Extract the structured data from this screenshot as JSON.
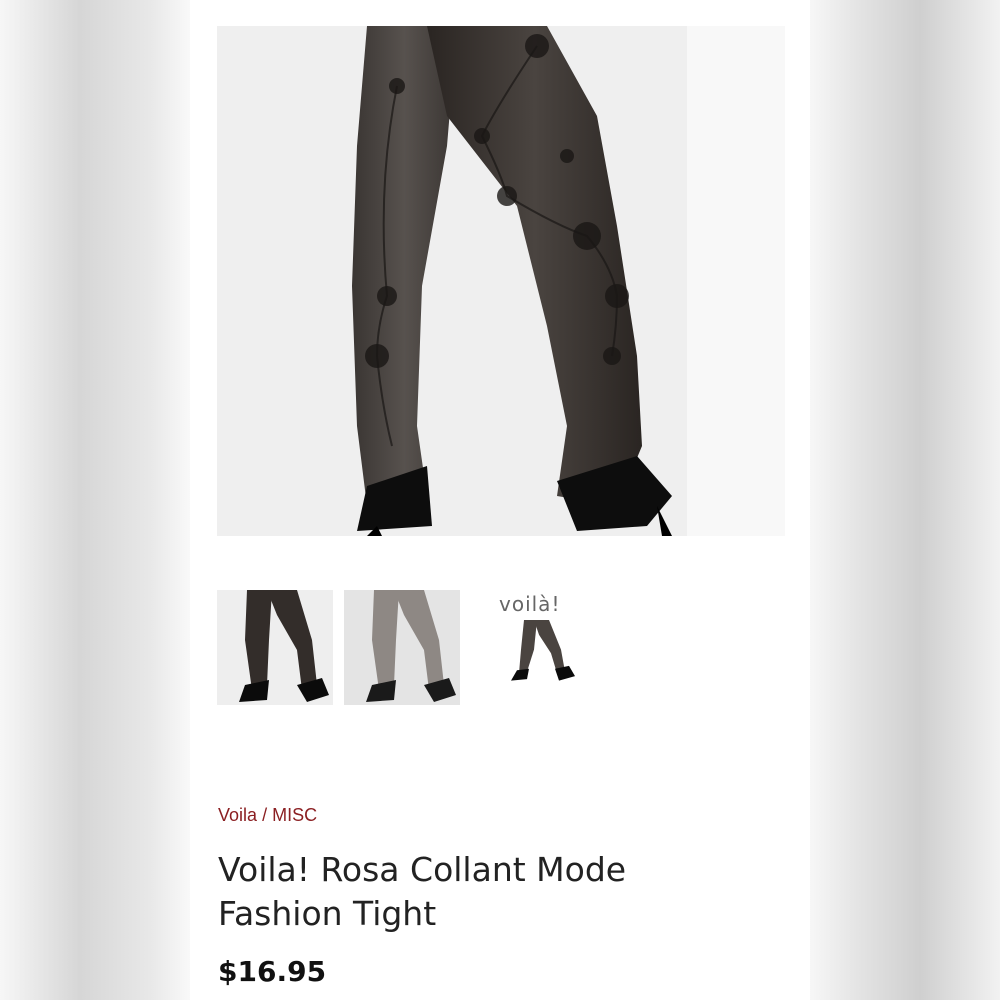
{
  "breadcrumb": {
    "brand": "Voila",
    "separator": "/",
    "category": "MISC"
  },
  "product": {
    "title": "Voila! Rosa Collant Mode Fashion Tight",
    "price": "$16.95"
  },
  "gallery": {
    "main_image": "product-image-floral-tights-legs",
    "thumbnails": [
      {
        "name": "thumbnail-black-floral-tights"
      },
      {
        "name": "thumbnail-grey-floral-tights"
      },
      {
        "name": "thumbnail-brand-image",
        "brand_text": "voilà!"
      }
    ]
  },
  "colors": {
    "accent": "#8b1f22",
    "text": "#222222",
    "price": "#111111"
  }
}
